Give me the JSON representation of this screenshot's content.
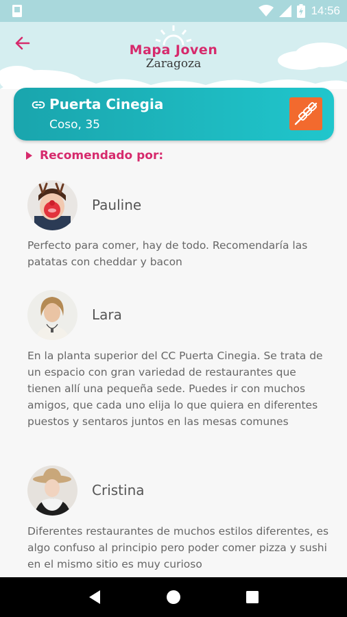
{
  "status_bar": {
    "time": "14:56"
  },
  "header": {
    "logo_title": "Mapa Joven",
    "logo_subtitle": "Zaragoza"
  },
  "place": {
    "name": "Puerta Cinegia",
    "address": "Coso, 35",
    "category_icon": "skewer-icon"
  },
  "recommended_heading": "Recomendado por:",
  "reviews": [
    {
      "name": "Pauline",
      "text": "Perfecto para comer, hay de todo. Recomendaría las patatas con cheddar y bacon"
    },
    {
      "name": "Lara",
      "text": "En la planta superior del CC Puerta Cinegia. Se trata de un espacio con gran variedad de restaurantes que tienen allí una pequeña sede. Puedes ir con muchos amigos, que cada uno elija lo que quiera en diferentes puestos y sentaros juntos en las mesas comunes"
    },
    {
      "name": "Cristina",
      "text": "Diferentes restaurantes de muchos estilos diferentes, es algo confuso al principio pero poder comer pizza y sushi en el mismo sitio es muy curioso"
    }
  ],
  "colors": {
    "brand_pink": "#d62a6c",
    "card_teal": "#1aa5ad",
    "badge_orange": "#f26a2e",
    "header_bg": "#d5eef0"
  }
}
